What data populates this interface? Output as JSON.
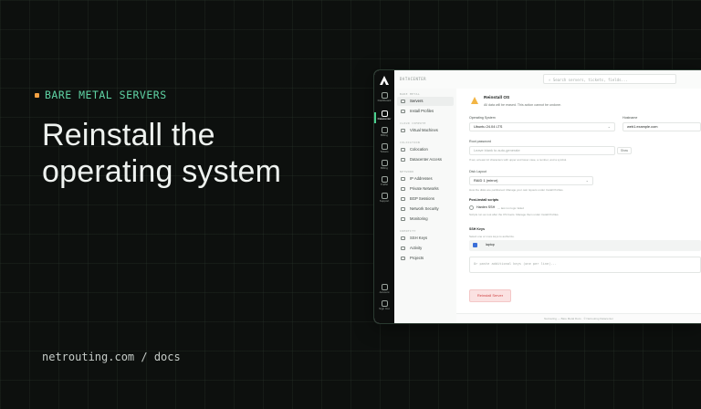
{
  "hero": {
    "eyebrow": "BARE METAL SERVERS",
    "headline_line1": "Reinstall the",
    "headline_line2": "operating system",
    "footer": "netrouting.com / docs"
  },
  "app": {
    "topbar_title": "DATACENTER",
    "search_placeholder": "⌕ Search servers, tickets, fields...",
    "rail": [
      {
        "label": "Dashboard",
        "icon": "dashboard-icon"
      },
      {
        "label": "Datacenter",
        "icon": "server-icon"
      },
      {
        "label": "Billing",
        "icon": "cart-icon"
      },
      {
        "label": "Tickets",
        "icon": "ticket-icon"
      },
      {
        "label": "Billing",
        "icon": "document-icon"
      },
      {
        "label": "Traffic",
        "icon": "traffic-icon"
      },
      {
        "label": "Support",
        "icon": "support-icon"
      }
    ],
    "rail_bottom": [
      {
        "label": "Account",
        "icon": "user-icon"
      },
      {
        "label": "Sign Out",
        "icon": "signout-icon"
      }
    ],
    "sidebar": {
      "sec1": "BARE METAL",
      "servers": "Servers",
      "install_profiles": "Install Profiles",
      "sec2": "CLOUD COMPUTE",
      "virtual_machines": "Virtual Machines",
      "sec3": "COLOCATION",
      "colocation": "Colocation",
      "datacenter_access": "Datacenter Access",
      "sec4": "NETWORK",
      "ip_addresses": "IP Addresses",
      "private_networks": "Private Networks",
      "bgp_sessions": "BGP Sessions",
      "network_security": "Network Security",
      "monitoring": "Monitoring",
      "sec5": "IDENTITY",
      "ssh_keys": "SSH Keys",
      "activity": "Activity",
      "projects": "Projects"
    },
    "form": {
      "alert_title": "Reinstall OS",
      "alert_desc": "All data will be erased. This action cannot be undone.",
      "os_label": "Operating System",
      "os_value": "Ubuntu 24.04 LTS",
      "hostname_label": "Hostname",
      "hostname_value": "web1.example.com",
      "root_label": "Root password",
      "root_placeholder": "Leave blank to auto-generate",
      "show_button": "Show",
      "root_helper": "If set, at least 12 characters with upper and lower case, a number, and a symbol.",
      "disk_label": "Disk Layout",
      "disk_value": "RAID 1 (mirror)",
      "disk_helper": "How the disks are partitioned. Manage your own layouts under Install Profiles.",
      "post_label": "Post-install scripts",
      "post_option": "Harden SSH",
      "post_option_note": "— last run logs: failed",
      "post_helper": "Scripts run as root after the OS boots. Manage them under Install Profiles.",
      "ssh_label": "SSH Keys",
      "ssh_helper": "Select one or more keys to authorize.",
      "ssh_key": "laptop",
      "textarea_placeholder": "Or paste additional keys (one per line)...",
      "submit": "Reinstall Server"
    },
    "statusbar": "Netrouting — Bare Metal Docs · © Netrouting Datacenter"
  }
}
